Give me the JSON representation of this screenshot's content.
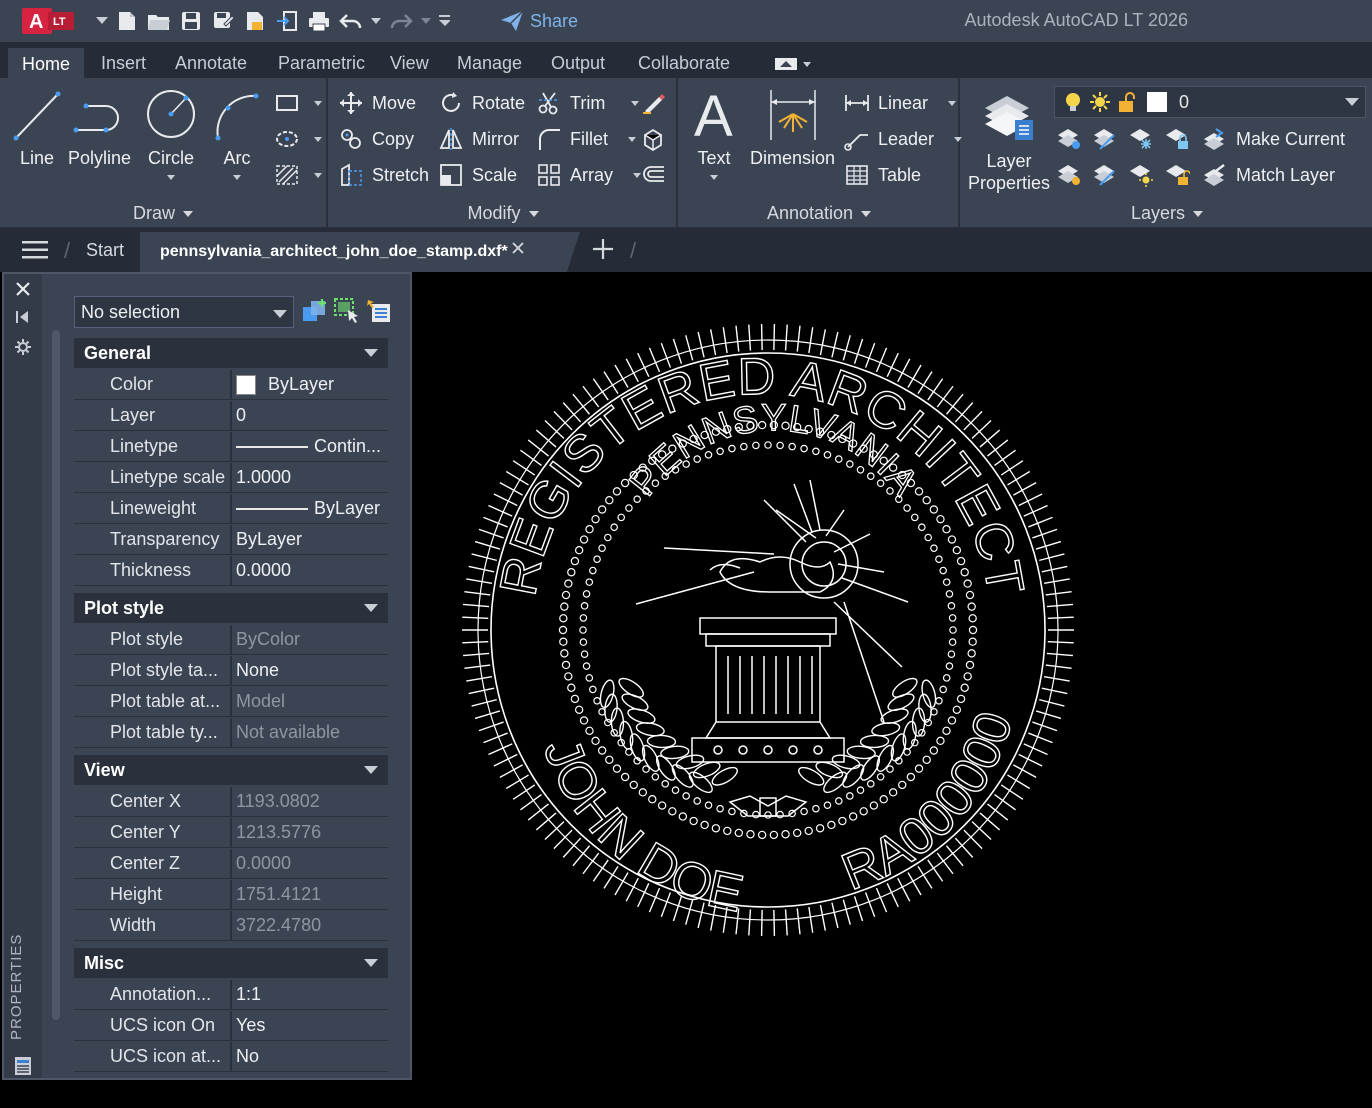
{
  "app": {
    "badge": "LT",
    "title": "Autodesk AutoCAD LT 2026",
    "share": "Share"
  },
  "ribbon_tabs": [
    "Home",
    "Insert",
    "Annotate",
    "Parametric",
    "View",
    "Manage",
    "Output",
    "Collaborate"
  ],
  "draw": {
    "title": "Draw",
    "line": "Line",
    "polyline": "Polyline",
    "circle": "Circle",
    "arc": "Arc"
  },
  "modify": {
    "title": "Modify",
    "move": "Move",
    "rotate": "Rotate",
    "trim": "Trim",
    "copy": "Copy",
    "mirror": "Mirror",
    "fillet": "Fillet",
    "stretch": "Stretch",
    "scale": "Scale",
    "array": "Array"
  },
  "annotation": {
    "title": "Annotation",
    "text": "Text",
    "dimension": "Dimension",
    "linear": "Linear",
    "leader": "Leader",
    "table": "Table"
  },
  "layers": {
    "title": "Layers",
    "properties_l1": "Layer",
    "properties_l2": "Properties",
    "current": "0",
    "make_current": "Make Current",
    "match_layer": "Match Layer"
  },
  "doc": {
    "start": "Start",
    "filename": "pennsylvania_architect_john_doe_stamp.dxf*"
  },
  "properties": {
    "palette_label": "PROPERTIES",
    "selection": "No selection",
    "sections": [
      {
        "name": "General",
        "rows": [
          {
            "k": "Color",
            "v": "ByLayer"
          },
          {
            "k": "Layer",
            "v": "0"
          },
          {
            "k": "Linetype",
            "v": "Contin..."
          },
          {
            "k": "Linetype scale",
            "v": "1.0000"
          },
          {
            "k": "Lineweight",
            "v": "ByLayer"
          },
          {
            "k": "Transparency",
            "v": "ByLayer"
          },
          {
            "k": "Thickness",
            "v": "0.0000"
          }
        ]
      },
      {
        "name": "Plot style",
        "rows": [
          {
            "k": "Plot style",
            "v": "ByColor"
          },
          {
            "k": "Plot style ta...",
            "v": "None"
          },
          {
            "k": "Plot table at...",
            "v": "Model"
          },
          {
            "k": "Plot table ty...",
            "v": "Not available"
          }
        ]
      },
      {
        "name": "View",
        "rows": [
          {
            "k": "Center X",
            "v": "1193.0802"
          },
          {
            "k": "Center Y",
            "v": "1213.5776"
          },
          {
            "k": "Center Z",
            "v": "0.0000"
          },
          {
            "k": "Height",
            "v": "1751.4121"
          },
          {
            "k": "Width",
            "v": "3722.4780"
          }
        ]
      },
      {
        "name": "Misc",
        "rows": [
          {
            "k": "Annotation...",
            "v": "1:1"
          },
          {
            "k": "UCS icon On",
            "v": "Yes"
          },
          {
            "k": "UCS icon at...",
            "v": "No"
          }
        ]
      }
    ]
  },
  "stamp": {
    "outer": "REGISTERED ARCHITECT",
    "inner": "PENNSYLVANIA",
    "name": "JOHN DOE",
    "number": "RA000000"
  },
  "colors": {
    "ribbon": "#3b4453",
    "tabbar": "#252c37",
    "share": "#7fb3ea",
    "logo_red": "#d62440"
  }
}
